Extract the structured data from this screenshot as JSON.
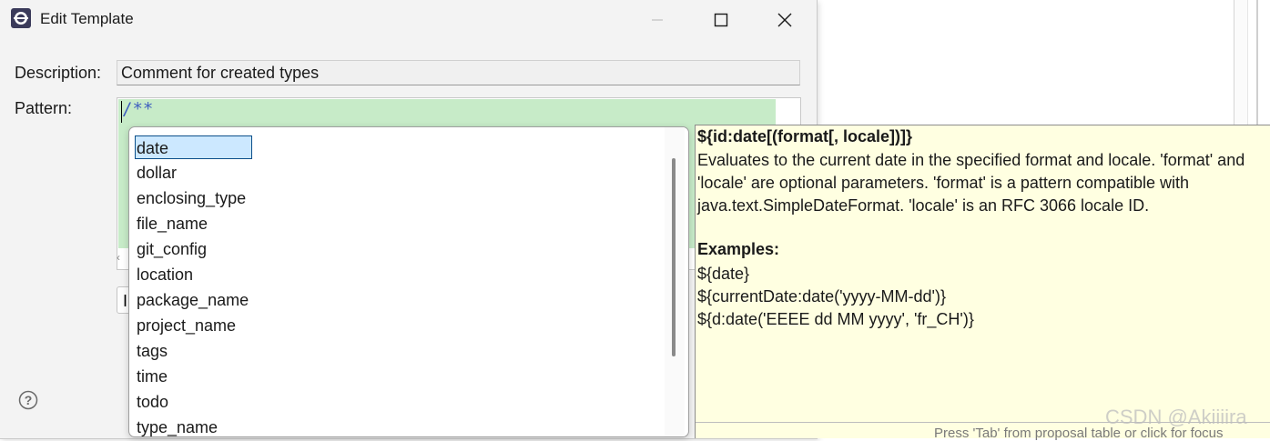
{
  "dialog": {
    "title": "Edit Template",
    "description_label": "Description:",
    "description_value": "Comment for created types",
    "pattern_label": "Pattern:",
    "pattern_text": "/**",
    "insert_button_partial": "I"
  },
  "proposals": {
    "items": [
      "date",
      "dollar",
      "enclosing_type",
      "file_name",
      "git_config",
      "location",
      "package_name",
      "project_name",
      "tags",
      "time",
      "todo",
      "type_name"
    ],
    "selected_index": 0
  },
  "info": {
    "signature": "${id:date[(format[, locale])]}",
    "description": "Evaluates to the current date in the specified format and locale. 'format' and 'locale' are optional parameters. 'format' is a pattern compatible with java.text.SimpleDateFormat. 'locale' is an RFC 3066 locale ID.",
    "examples_heading": "Examples:",
    "examples": [
      "${date}",
      "${currentDate:date('yyyy-MM-dd')}",
      "${d:date('EEEE dd MM yyyy', 'fr_CH')}"
    ],
    "footer": "Press 'Tab' from proposal table or click for focus"
  },
  "watermark": "CSDN @Akiiiira",
  "colors": {
    "pattern_highlight": "#c7ebc8",
    "selection": "#cce8ff",
    "info_background": "#ffffe1",
    "comment_blue": "#3f5fbf"
  }
}
